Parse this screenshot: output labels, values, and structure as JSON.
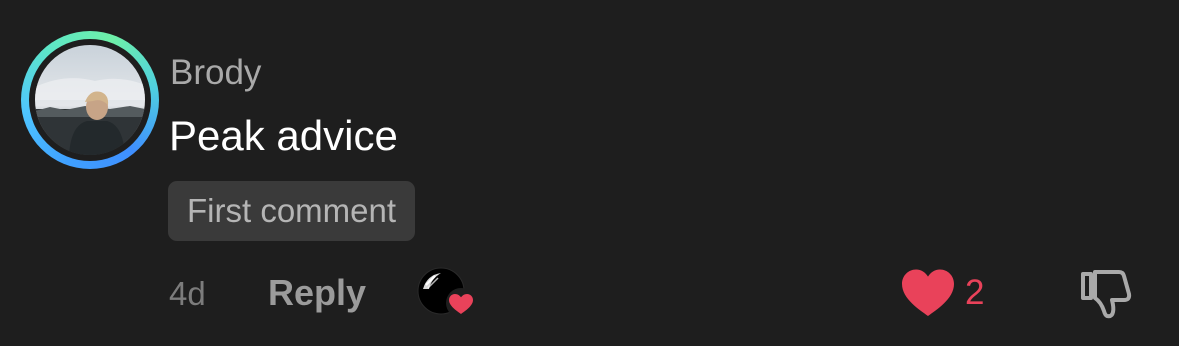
{
  "comment": {
    "username": "Brody",
    "text": "Peak advice",
    "badge": "First comment",
    "timestamp": "4d",
    "reply_label": "Reply",
    "like_count": "2",
    "liked_by_creator": true,
    "has_story_ring": true
  },
  "icons": {
    "avatar": "profile-photo",
    "creator_liked": "creator-avatar-with-heart-icon",
    "like": "heart-icon",
    "dislike": "thumbs-down-icon"
  },
  "colors": {
    "background": "#1e1e1e",
    "like_red": "#e9425a",
    "username_gray": "#a9a9a9",
    "badge_bg": "#3a3a3a",
    "ring_blue": "#3fa0ff",
    "ring_green": "#6ef0a8"
  }
}
